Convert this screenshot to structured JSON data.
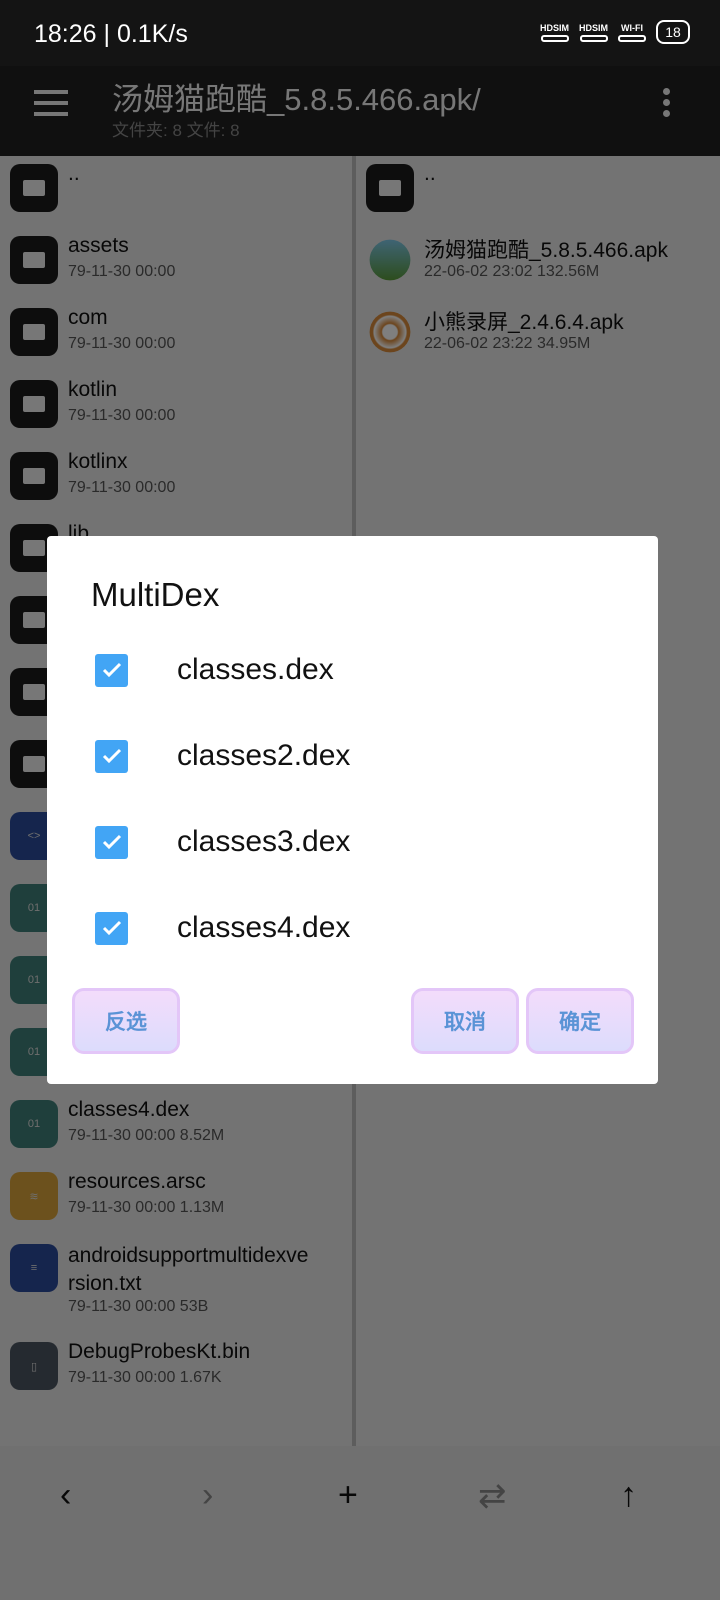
{
  "status_bar": {
    "time": "18:26 | 0.1K/s",
    "sim1": "HDSIM",
    "sim2": "HDSIM",
    "wifi": "WI-FI",
    "battery": "18"
  },
  "header": {
    "title": "汤姆猫跑酷_5.8.5.466.apk/",
    "subtitle": "文件夹: 8   文件: 8"
  },
  "left_pane": {
    "items": [
      {
        "name": "..",
        "meta": "",
        "icon": "folder"
      },
      {
        "name": "assets",
        "meta": "79-11-30 00:00",
        "icon": "folder"
      },
      {
        "name": "com",
        "meta": "79-11-30 00:00",
        "icon": "folder"
      },
      {
        "name": "kotlin",
        "meta": "79-11-30 00:00",
        "icon": "folder"
      },
      {
        "name": "kotlinx",
        "meta": "79-11-30 00:00",
        "icon": "folder"
      },
      {
        "name": "lib",
        "meta": "",
        "icon": "folder"
      },
      {
        "name": "",
        "meta": "",
        "icon": "folder"
      },
      {
        "name": "",
        "meta": "",
        "icon": "folder"
      },
      {
        "name": "",
        "meta": "",
        "icon": "folder"
      },
      {
        "name": "",
        "meta": "",
        "icon": "xml-file"
      },
      {
        "name": "",
        "meta": "",
        "icon": "dex-file"
      },
      {
        "name": "",
        "meta": "",
        "icon": "dex-file"
      },
      {
        "name": "",
        "meta": "",
        "icon": "dex-file"
      },
      {
        "name": "classes4.dex",
        "meta": "79-11-30 00:00  8.52M",
        "icon": "dex-file"
      },
      {
        "name": "resources.arsc",
        "meta": "79-11-30 00:00  1.13M",
        "icon": "layers"
      },
      {
        "name": "androidsupportmultidexve\nrsion.txt",
        "meta": "79-11-30 00:00  53B",
        "icon": "text-file"
      },
      {
        "name": "DebugProbesKt.bin",
        "meta": "79-11-30 00:00  1.67K",
        "icon": "file"
      }
    ]
  },
  "right_pane": {
    "items": [
      {
        "name": "..",
        "meta": "",
        "icon": "folder"
      },
      {
        "name": "汤姆猫跑酷_5.8.5.466.apk",
        "meta": "22-06-02 23:02  132.56M",
        "icon": "app-icon"
      },
      {
        "name": "小熊录屏_2.4.6.4.apk",
        "meta": "22-06-02 23:22  34.95M",
        "icon": "app-icon"
      }
    ]
  },
  "bottom_bar": {
    "back": "‹",
    "forward": "›",
    "add": "+",
    "swap": "⇄",
    "up": "↑"
  },
  "dialog": {
    "title": "MultiDex",
    "options": [
      {
        "label": "classes.dex",
        "checked": true
      },
      {
        "label": "classes2.dex",
        "checked": true
      },
      {
        "label": "classes3.dex",
        "checked": true
      },
      {
        "label": "classes4.dex",
        "checked": true
      }
    ],
    "invert_label": "反选",
    "cancel_label": "取消",
    "ok_label": "确定"
  },
  "colors": {
    "accent": "#42a5f5",
    "button_text": "#5a93d6"
  }
}
